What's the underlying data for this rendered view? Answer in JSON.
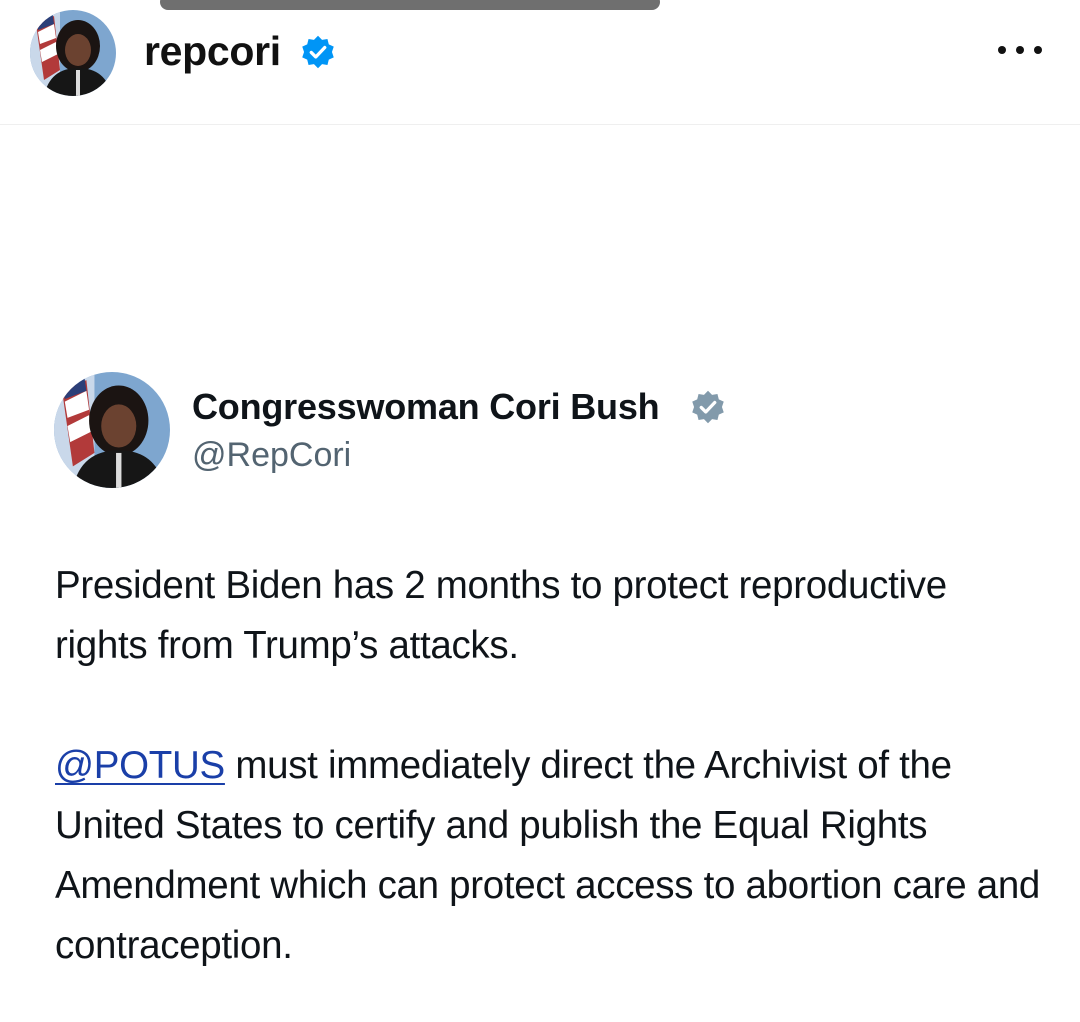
{
  "post_header": {
    "username": "repcori",
    "verified_icon": "verified-badge-icon",
    "more_icon": "more-options-icon"
  },
  "tweet": {
    "display_name": "Congresswoman Cori Bush",
    "handle": "@RepCori",
    "verified_icon": "verified-badge-icon",
    "paragraph_1": "President Biden has 2 months to protect reproductive rights from Trump’s attacks.",
    "mention": "@POTUS",
    "paragraph_2_rest": " must immediately direct the Archivist of the United States to certify and publish the Equal Rights Amendment which can protect access to abortion care and contraception."
  },
  "colors": {
    "ig_verified_blue": "#0095f6",
    "x_verified_gray": "#829aab",
    "mention_blue": "#1a3fa8",
    "handle_gray": "#536471"
  }
}
